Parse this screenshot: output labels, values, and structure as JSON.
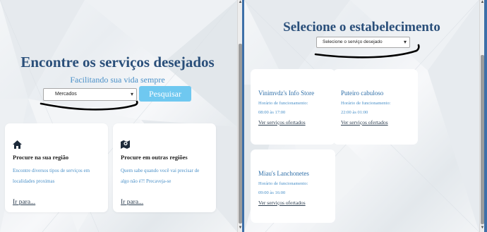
{
  "left": {
    "title": "Encontre os serviços desejados",
    "subtitle": "Facilitando sua vida sempre",
    "select_value": "Mercados",
    "search_label": "Pesquisar",
    "cards": [
      {
        "icon": "home-icon",
        "title": "Procure na sua região",
        "desc": "Encontre diversos tipos de serviços em localidades proximas",
        "link": "Ir para..."
      },
      {
        "icon": "map-marker-icon",
        "title": "Procure em outras regiões",
        "desc": "Quem sabe quando você vai precisar de algo não é?! Precaveja-se",
        "link": "Ir para..."
      }
    ]
  },
  "right": {
    "title": "Selecione o estabelecimento",
    "select_value": "Selecione o serviço desejado",
    "shops": [
      {
        "name": "Vinimvdz's Info Store",
        "label": "Horário de funcionamento:",
        "hours": "08:00 às 17:00",
        "link": "Ver serviços ofertados"
      },
      {
        "name": "Puteiro cabuloso",
        "label": "Horário de funcionamento:",
        "hours": "22:00 às 01:00",
        "link": "Ver serviços ofertados"
      },
      {
        "name": "Miau's Lanchonetes",
        "label": "Horário de funcionamento:",
        "hours": "09:00 às 16:00",
        "link": "Ver serviços ofertados"
      }
    ]
  },
  "colors": {
    "title": "#2a4f7a",
    "accent": "#4a90c8",
    "button": "#6fc8f0",
    "frame": "#3d6fa8"
  }
}
